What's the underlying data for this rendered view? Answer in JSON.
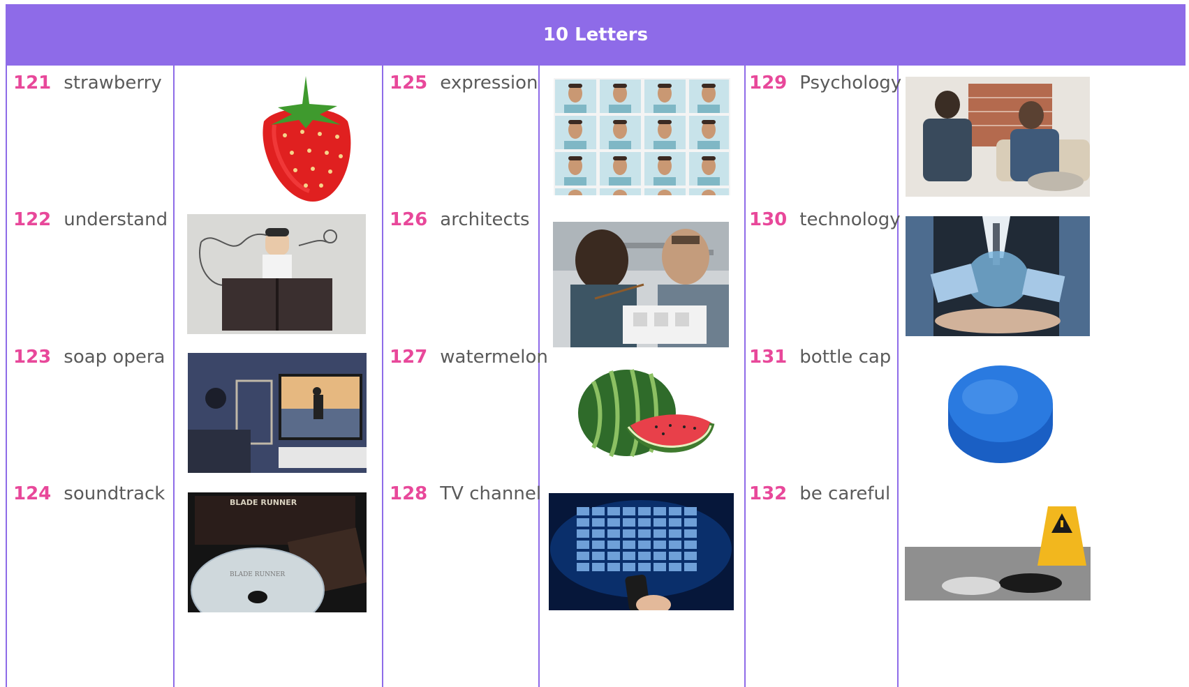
{
  "header": {
    "title": "10 Letters"
  },
  "items": [
    {
      "number": "121",
      "word": "strawberry",
      "image": "strawberry-image"
    },
    {
      "number": "122",
      "word": "understand",
      "image": "man-reading-book-image"
    },
    {
      "number": "123",
      "word": "soap opera",
      "image": "couple-watching-tv-image"
    },
    {
      "number": "124",
      "word": "soundtrack",
      "image": "movie-dvd-cd-image"
    },
    {
      "number": "125",
      "word": "expression",
      "image": "facial-expressions-grid-image"
    },
    {
      "number": "126",
      "word": "architects",
      "image": "architects-model-image"
    },
    {
      "number": "127",
      "word": "watermelon",
      "image": "watermelon-image"
    },
    {
      "number": "128",
      "word": "TV channel",
      "image": "tv-channels-remote-image"
    },
    {
      "number": "129",
      "word": "Psychology",
      "image": "therapy-session-image"
    },
    {
      "number": "130",
      "word": "technology",
      "image": "tech-devices-hands-image"
    },
    {
      "number": "131",
      "word": "bottle cap",
      "image": "blue-bottle-cap-image"
    },
    {
      "number": "132",
      "word": "be careful",
      "image": "caution-sign-manhole-image"
    }
  ],
  "colors": {
    "header_bg": "#8e6be8",
    "grid_line": "#8e6be8",
    "number": "#e8489a",
    "word": "#5a5a5a"
  }
}
